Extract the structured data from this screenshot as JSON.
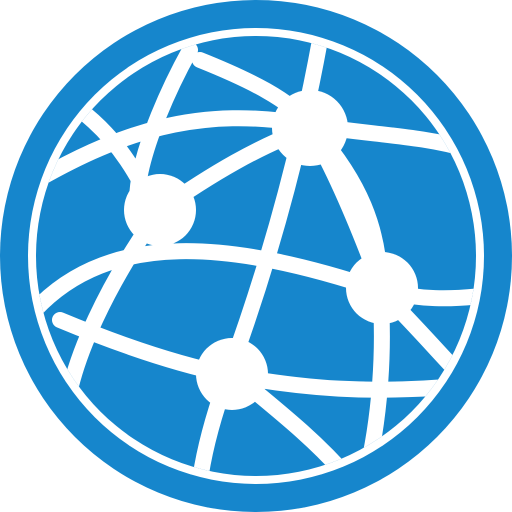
{
  "icon": {
    "name": "network-globe-icon",
    "colors": {
      "primary": "#1686CC",
      "background": "#FFFFFF"
    },
    "node_count": 4
  }
}
